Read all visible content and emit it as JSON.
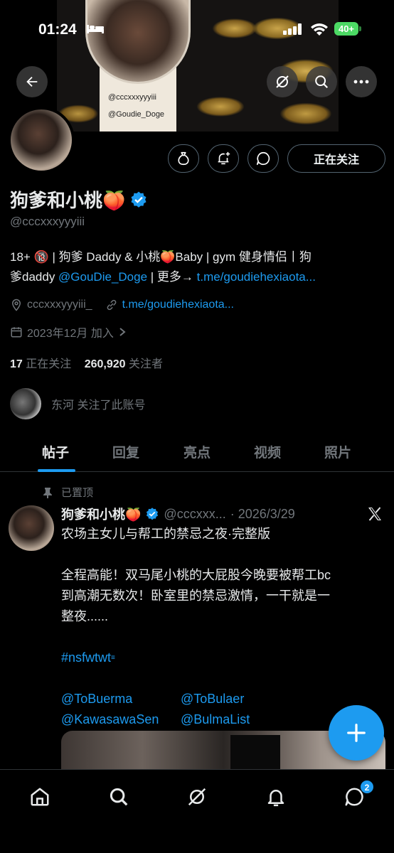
{
  "status_bar": {
    "time": "01:24",
    "battery": "40+"
  },
  "banner": {
    "handle_1": "@cccxxxyyyiii",
    "handle_2": "@Goudie_Doge"
  },
  "profile": {
    "name": "狗爹和小桃🍑",
    "handle": "@cccxxxyyyiii",
    "follow_button": "正在关注",
    "bio_1": "18+ 🔞 | 狗爹 Daddy & 小桃🍑Baby | gym 健身情侣丨狗",
    "bio_2a": "爹daddy ",
    "bio_2_link": "@GouDie_Doge",
    "bio_2b": " | 更多→ ",
    "bio_2_url": "t.me/goudiehexiaota...",
    "location": "cccxxxyyyiii_",
    "website": "t.me/goudiehexiaota...",
    "joined": "2023年12月 加入",
    "following_count": "17",
    "following_label": "正在关注",
    "followers_count": "260,920",
    "followers_label": "关注者",
    "followed_by": "东河 关注了此账号"
  },
  "tabs": [
    "帖子",
    "回复",
    "亮点",
    "视频",
    "照片"
  ],
  "post": {
    "pinned_label": "已置顶",
    "name": "狗爹和小桃🍑",
    "handle": "@cccxxx...",
    "date": "· 2026/3/29",
    "line_1": "农场主女儿与帮工的禁忌之夜·完整版",
    "line_2": "全程高能！双马尾小桃的大屁股今晚要被帮工bc",
    "line_3": "到高潮无数次！卧室里的禁忌激情，一干就是一",
    "line_4": "整夜......",
    "hashtag": "#nsfwtwt",
    "mention_1": "@ToBuerma",
    "mention_2": "@ToBulaer",
    "mention_3": "@KawasawaSen",
    "mention_4": "@BulmaList"
  },
  "nav": {
    "messages_badge": "2"
  }
}
